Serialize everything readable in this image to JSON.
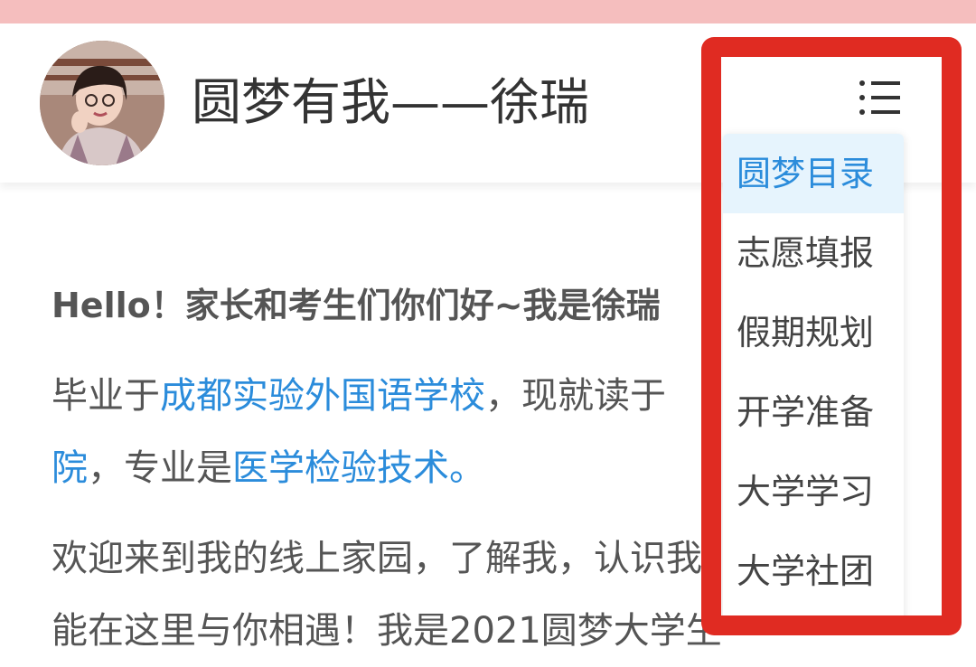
{
  "header": {
    "title": "圆梦有我——徐瑞",
    "avatar_alt": "avatar",
    "menu_icon": "list-menu-icon"
  },
  "menu": {
    "items": [
      {
        "label": "圆梦目录",
        "active": true
      },
      {
        "label": "志愿填报",
        "active": false
      },
      {
        "label": "假期规划",
        "active": false
      },
      {
        "label": "开学准备",
        "active": false
      },
      {
        "label": "大学学习",
        "active": false
      },
      {
        "label": "大学社团",
        "active": false
      }
    ]
  },
  "content": {
    "hello": "Hello！家长和考生们你们好~我是徐瑞",
    "p1_a": "毕业于",
    "p1_school": "成都实验外国语学校",
    "p1_b": "，现就读于",
    "p1_college_end": "院",
    "p1_c": "，专业是",
    "p1_major": "医学检验技术",
    "p1_d": "。",
    "p2_line1": "欢迎来到我的线上家园，了解我，认识我，开心",
    "p2_line2": "能在这里与你相遇！我是2021圆梦大学生"
  },
  "colors": {
    "link": "#2b8cdb",
    "highlight_border": "#e02b22",
    "active_bg": "#e6f4fd",
    "status_bar": "#f5bebe"
  }
}
